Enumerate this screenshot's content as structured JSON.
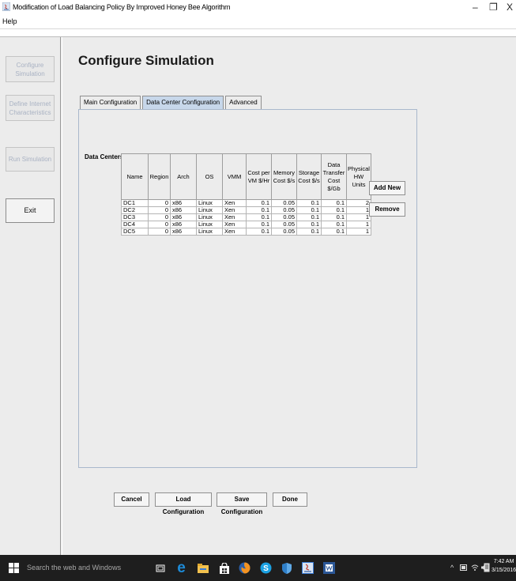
{
  "window": {
    "title": "Modification of Load Balancing Policy By Improved Honey Bee Algorithm",
    "controls": {
      "minimize": "–",
      "maximize": "❐",
      "close": "X"
    }
  },
  "menu": {
    "help": "Help"
  },
  "sidebar": {
    "configure_simulation": "Configure Simulation",
    "define_internet": "Define Internet Characteristics",
    "run_simulation": "Run Simulation",
    "exit": "Exit"
  },
  "main": {
    "title": "Configure Simulation",
    "tabs": [
      {
        "label": "Main Configuration"
      },
      {
        "label": "Data Center Configuration"
      },
      {
        "label": "Advanced"
      }
    ],
    "data_centers_label": "Data Centers:",
    "columns": [
      "Name",
      "Region",
      "Arch",
      "OS",
      "VMM",
      "Cost per VM $/Hr",
      "Memory Cost $/s",
      "Storage Cost $/s",
      "Data Transfer Cost $/Gb",
      "Physical HW Units"
    ],
    "rows": [
      [
        "DC1",
        "0",
        "x86",
        "Linux",
        "Xen",
        "0.1",
        "0.05",
        "0.1",
        "0.1",
        "2"
      ],
      [
        "DC2",
        "0",
        "x86",
        "Linux",
        "Xen",
        "0.1",
        "0.05",
        "0.1",
        "0.1",
        "1"
      ],
      [
        "DC3",
        "0",
        "x86",
        "Linux",
        "Xen",
        "0.1",
        "0.05",
        "0.1",
        "0.1",
        "1"
      ],
      [
        "DC4",
        "0",
        "x86",
        "Linux",
        "Xen",
        "0.1",
        "0.05",
        "0.1",
        "0.1",
        "1"
      ],
      [
        "DC5",
        "0",
        "x86",
        "Linux",
        "Xen",
        "0.1",
        "0.05",
        "0.1",
        "0.1",
        "1"
      ]
    ],
    "add_new": "Add New",
    "remove": "Remove",
    "buttons": {
      "cancel": "Cancel",
      "load": "Load Configuration",
      "save": "Save Configuration",
      "done": "Done"
    }
  },
  "taskbar": {
    "search_placeholder": "Search the web and Windows",
    "time": "7:42 AM",
    "date": "3/15/2016",
    "tray_icons": [
      "chevron-up-icon",
      "battery-icon",
      "wifi-icon",
      "volume-icon",
      "notification-icon"
    ],
    "apps": [
      "task-view-icon",
      "edge-icon",
      "file-explorer-icon",
      "store-icon",
      "firefox-icon",
      "skype-icon",
      "shield-icon",
      "java-icon",
      "word-icon"
    ]
  },
  "colors": {
    "tab_active": "#c7d7ea",
    "panel_border": "#a9b8cc",
    "disabled_text": "#a9b2c3",
    "taskbar": "#1e1e1e",
    "edge_blue": "#1d8bd8",
    "java_blue": "#3a7bd5",
    "word_blue": "#2b5797"
  }
}
